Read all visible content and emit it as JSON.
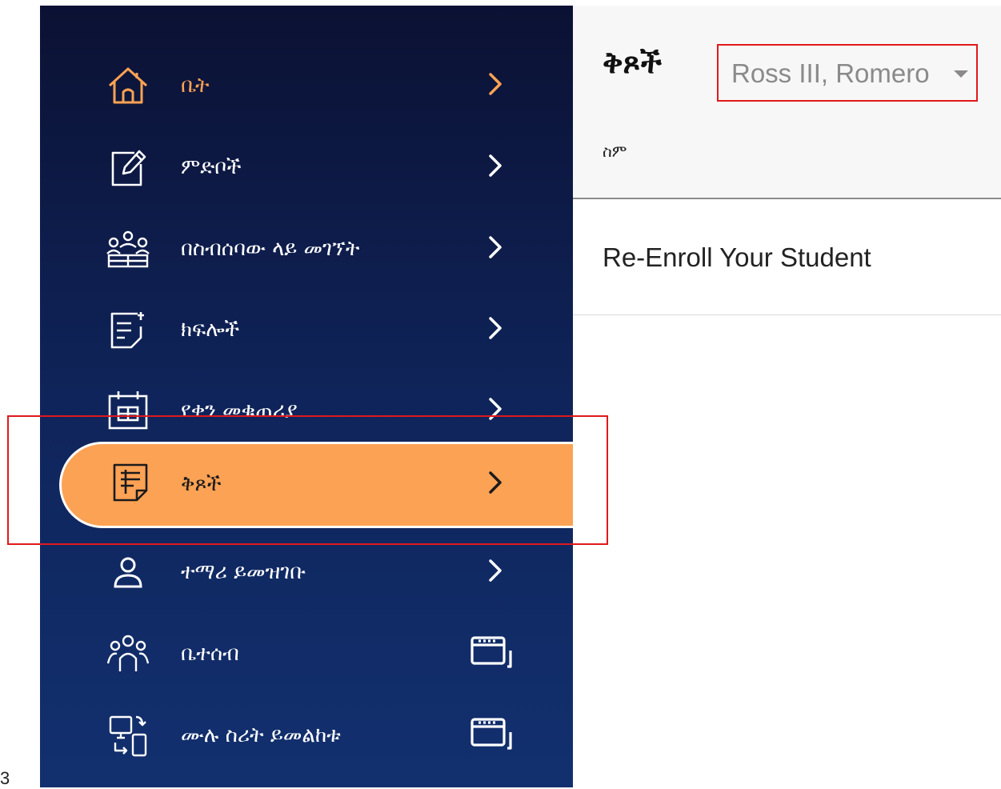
{
  "stray_text": "3",
  "sidebar": {
    "items": [
      {
        "label": "ቤት",
        "icon": "home-icon",
        "trailing": "chevron-right-icon"
      },
      {
        "label": "ምድቦች",
        "icon": "edit-icon",
        "trailing": "chevron-right-icon"
      },
      {
        "label": "በስብሰባው ላይ መገኘት",
        "icon": "attendance-icon",
        "trailing": "chevron-right-icon"
      },
      {
        "label": "ክፍሎች",
        "icon": "document-icon",
        "trailing": "chevron-right-icon"
      },
      {
        "label": "የቀን መቁጠሪያ",
        "icon": "calendar-icon",
        "trailing": "chevron-right-icon"
      },
      {
        "label": "ቅጾች",
        "icon": "forms-icon",
        "trailing": "chevron-right-icon",
        "active": true
      },
      {
        "label": "ተማሪ ይመዝገቡ",
        "icon": "person-icon",
        "trailing": "chevron-right-icon"
      },
      {
        "label": "ቤተሰብ",
        "icon": "family-icon",
        "trailing": "external-window-icon"
      },
      {
        "label": "ሙሉ ስሪት ይመልከቱ",
        "icon": "switch-device-icon",
        "trailing": "external-window-icon"
      }
    ]
  },
  "main": {
    "title": "ቅጾች",
    "student_select": {
      "value": "Ross III, Romero"
    },
    "table": {
      "column_header": "ስም",
      "rows": [
        {
          "name": "Re-Enroll Your Student"
        }
      ]
    }
  },
  "colors": {
    "sidebar_top": "#0b1133",
    "sidebar_bottom": "#12306f",
    "active_item": "#fca254",
    "home_icon": "#fca254",
    "highlight_box": "#e0191c"
  }
}
